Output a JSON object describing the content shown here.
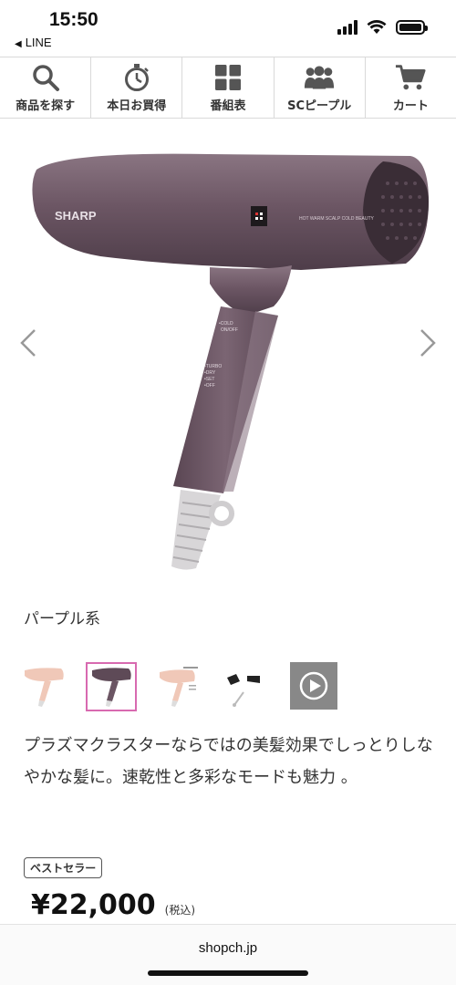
{
  "status_bar": {
    "time": "15:50",
    "back_app": "LINE",
    "back_icon": "back-triangle-icon",
    "icons": [
      "signal-icon",
      "wifi-icon",
      "battery-icon"
    ]
  },
  "nav": {
    "items": [
      {
        "label": "商品を探す",
        "icon": "search-icon"
      },
      {
        "label": "本日お買得",
        "icon": "stopwatch-icon"
      },
      {
        "label": "番組表",
        "icon": "grid-icon"
      },
      {
        "label": "SCピープル",
        "icon": "people-icon"
      },
      {
        "label": "カート",
        "icon": "cart-icon"
      }
    ]
  },
  "product": {
    "image_icon": "hair-dryer-image",
    "brand_on_device": "SHARP",
    "device_labels": {
      "modes": "HOT  WARM  SCALP  COLD  BEAUTY",
      "mode_button": "MODE",
      "beauty_button": "BEAUTY",
      "cold_switch": "•COLD\nON/OFF",
      "power_switch": "•TURBO\n•DRY\n•SET\n•OFF"
    },
    "color_name": "パープル系",
    "thumbnails": [
      {
        "name": "thumb-pink-dryer",
        "selected": false
      },
      {
        "name": "thumb-purple-dryer",
        "selected": true
      },
      {
        "name": "thumb-pink-dryer-info",
        "selected": false
      },
      {
        "name": "thumb-attachments",
        "selected": false
      },
      {
        "name": "thumb-video",
        "selected": false,
        "icon": "play-icon"
      }
    ],
    "description": "プラズマクラスターならではの美髪効果でしっとりしなやかな髪に。速乾性と多彩なモードも魅力 。",
    "badge": "ベストセラー",
    "price": "¥22,000",
    "tax_label": "(税込)"
  },
  "browser": {
    "url": "shopch.jp"
  },
  "colors": {
    "accent_border": "#d86ab0",
    "dryer_body": "#6b5563",
    "divider": "#d9d9d9"
  }
}
